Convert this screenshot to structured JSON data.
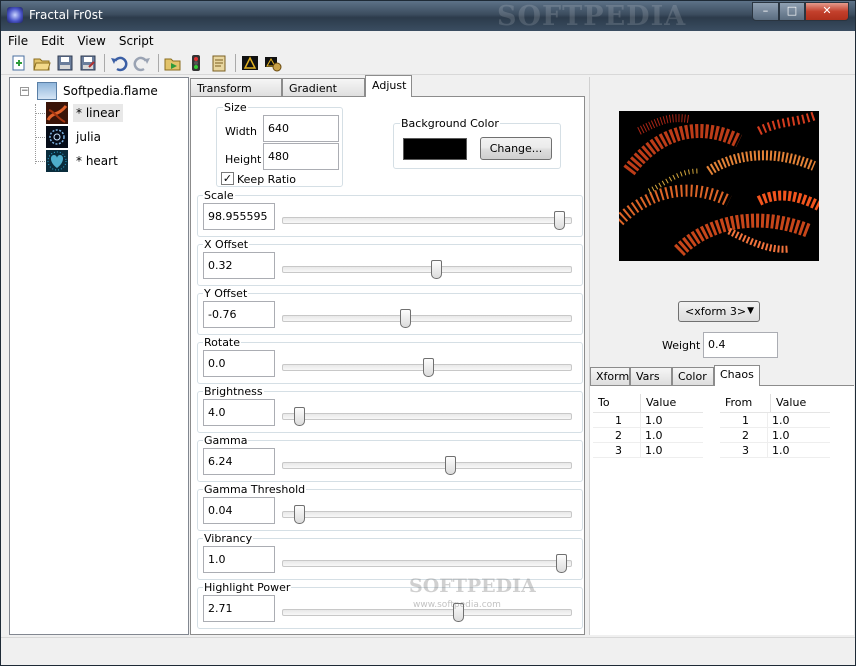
{
  "window": {
    "title": "Fractal Fr0st",
    "watermark": "SOFTPEDIA",
    "minimize_glyph": "–",
    "maximize_glyph": "□",
    "close_glyph": "✕"
  },
  "menu": [
    "File",
    "Edit",
    "View",
    "Script"
  ],
  "toolbar_icons": [
    "new-icon",
    "open-icon",
    "save-icon",
    "save-as-icon",
    "undo-icon",
    "redo-icon",
    "run-script-icon",
    "traffic-light-icon",
    "script-editor-icon",
    "render-icon",
    "render-all-icon"
  ],
  "tree": {
    "expander": "−",
    "root": "Softpedia.flame",
    "children": [
      {
        "label": "* linear",
        "selected": true,
        "icon": "linear-thumbnail-icon"
      },
      {
        "label": "julia",
        "selected": false,
        "icon": "julia-thumbnail-icon"
      },
      {
        "label": "* heart",
        "selected": false,
        "icon": "heart-thumbnail-icon"
      }
    ]
  },
  "tabs": [
    "Transform Editor",
    "Gradient Editor",
    "Adjust"
  ],
  "adjust": {
    "size": {
      "label": "Size",
      "width_label": "Width",
      "width": "640",
      "height_label": "Height",
      "height": "480",
      "keep_ratio": "Keep Ratio",
      "keep_ratio_checked": true,
      "check_glyph": "✓"
    },
    "background": {
      "label": "Background Color",
      "color": "#000000",
      "button": "Change..."
    },
    "sliders": [
      {
        "label": "Scale",
        "value": "98.955595",
        "pos": 0.97
      },
      {
        "label": "X Offset",
        "value": "0.32",
        "pos": 0.53
      },
      {
        "label": "Y Offset",
        "value": "-0.76",
        "pos": 0.42
      },
      {
        "label": "Rotate",
        "value": "0.0",
        "pos": 0.5
      },
      {
        "label": "Brightness",
        "value": "4.0",
        "pos": 0.04
      },
      {
        "label": "Gamma",
        "value": "6.24",
        "pos": 0.58
      },
      {
        "label": "Gamma Threshold",
        "value": "0.04",
        "pos": 0.04
      },
      {
        "label": "Vibrancy",
        "value": "1.0",
        "pos": 0.98
      },
      {
        "label": "Highlight Power",
        "value": "2.71",
        "pos": 0.61
      }
    ],
    "inner_watermark": "SOFTPEDIA",
    "inner_watermark_url": "www.softpedia.com"
  },
  "right": {
    "xform_select": "<xform 3>",
    "select_arrow": "▼",
    "weight_label": "Weight",
    "weight": "0.4",
    "tabs": [
      "Xform",
      "Vars",
      "Color",
      "Chaos"
    ],
    "chaos": {
      "to_table": {
        "headers": [
          "To",
          "Value"
        ],
        "rows": [
          [
            "1",
            "1.0"
          ],
          [
            "2",
            "1.0"
          ],
          [
            "3",
            "1.0"
          ]
        ]
      },
      "from_table": {
        "headers": [
          "From",
          "Value"
        ],
        "rows": [
          [
            "1",
            "1.0"
          ],
          [
            "2",
            "1.0"
          ],
          [
            "3",
            "1.0"
          ]
        ]
      }
    }
  },
  "colors": {
    "accent": "#3b4c5e",
    "preview_bg": "#000000"
  }
}
